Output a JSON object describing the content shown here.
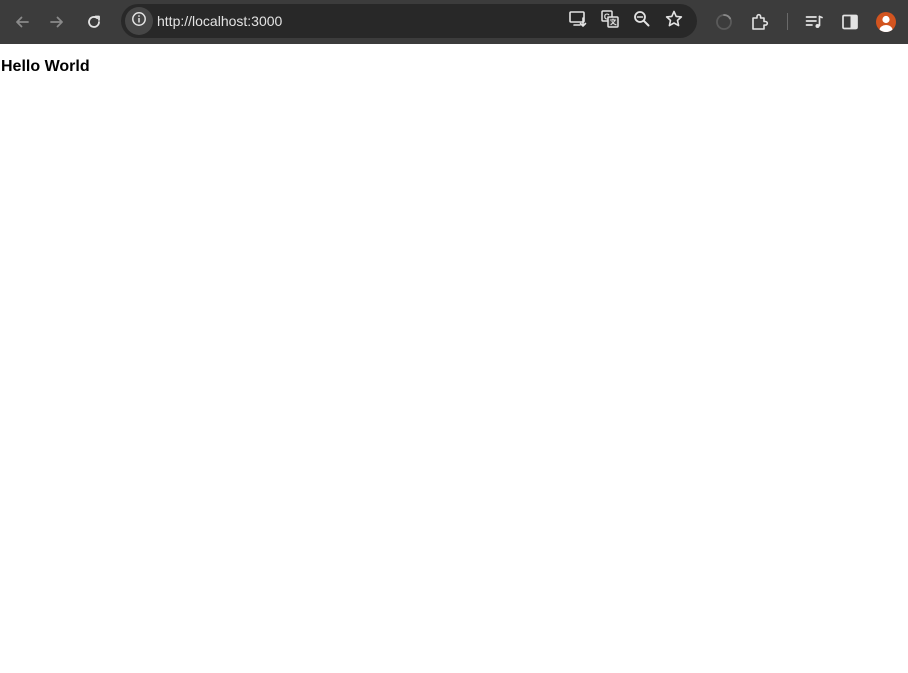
{
  "browser": {
    "url": "http://localhost:3000",
    "icons": {
      "back": "back-arrow-icon",
      "forward": "forward-arrow-icon",
      "reload": "reload-icon",
      "site_info": "info-icon",
      "install": "install-app-icon",
      "translate": "translate-icon",
      "zoom": "zoom-icon",
      "bookmark": "star-icon",
      "loading": "loading-spinner-icon",
      "extensions": "puzzle-icon",
      "media": "media-controls-icon",
      "side_panel": "side-panel-icon",
      "profile": "profile-avatar-icon"
    },
    "colors": {
      "toolbar": "#3c3c3c",
      "omnibox": "#282828",
      "avatar": "#d2541f"
    }
  },
  "page": {
    "heading": "Hello World"
  }
}
